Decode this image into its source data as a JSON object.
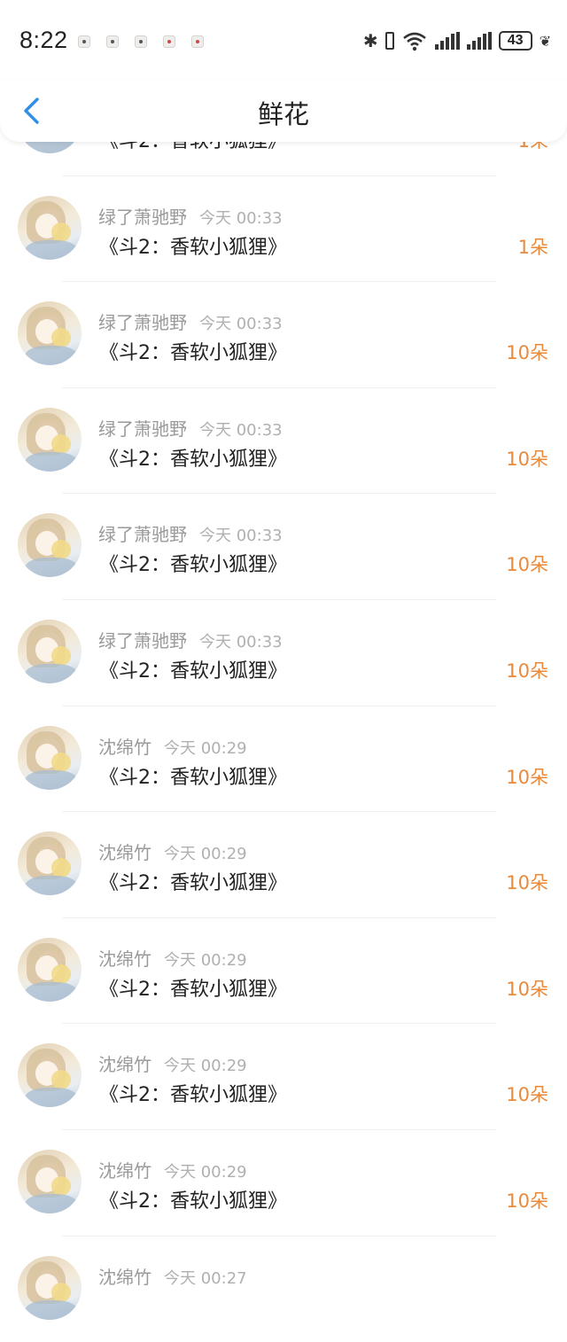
{
  "status_bar": {
    "time": "8:22",
    "battery": "43",
    "bluetooth_icon": "bluetooth-icon",
    "wifi_icon": "wifi-icon",
    "signal_icon": "signal-icon"
  },
  "header": {
    "title": "鲜花",
    "back_icon": "chevron-left-icon"
  },
  "colors": {
    "accent": "#2e8ee8",
    "count": "#e98a3b",
    "meta": "#9a9a9a"
  },
  "rows": [
    {
      "user": "",
      "time": "",
      "book": "《斗2：香软小狐狸》",
      "count": "1朵"
    },
    {
      "user": "绿了萧驰野",
      "time": "今天 00:33",
      "book": "《斗2：香软小狐狸》",
      "count": "1朵"
    },
    {
      "user": "绿了萧驰野",
      "time": "今天 00:33",
      "book": "《斗2：香软小狐狸》",
      "count": "10朵"
    },
    {
      "user": "绿了萧驰野",
      "time": "今天 00:33",
      "book": "《斗2：香软小狐狸》",
      "count": "10朵"
    },
    {
      "user": "绿了萧驰野",
      "time": "今天 00:33",
      "book": "《斗2：香软小狐狸》",
      "count": "10朵"
    },
    {
      "user": "绿了萧驰野",
      "time": "今天 00:33",
      "book": "《斗2：香软小狐狸》",
      "count": "10朵"
    },
    {
      "user": "沈绵竹",
      "time": "今天 00:29",
      "book": "《斗2：香软小狐狸》",
      "count": "10朵"
    },
    {
      "user": "沈绵竹",
      "time": "今天 00:29",
      "book": "《斗2：香软小狐狸》",
      "count": "10朵"
    },
    {
      "user": "沈绵竹",
      "time": "今天 00:29",
      "book": "《斗2：香软小狐狸》",
      "count": "10朵"
    },
    {
      "user": "沈绵竹",
      "time": "今天 00:29",
      "book": "《斗2：香软小狐狸》",
      "count": "10朵"
    },
    {
      "user": "沈绵竹",
      "time": "今天 00:29",
      "book": "《斗2：香软小狐狸》",
      "count": "10朵"
    },
    {
      "user": "沈绵竹",
      "time": "今天 00:27",
      "book": "",
      "count": ""
    }
  ]
}
